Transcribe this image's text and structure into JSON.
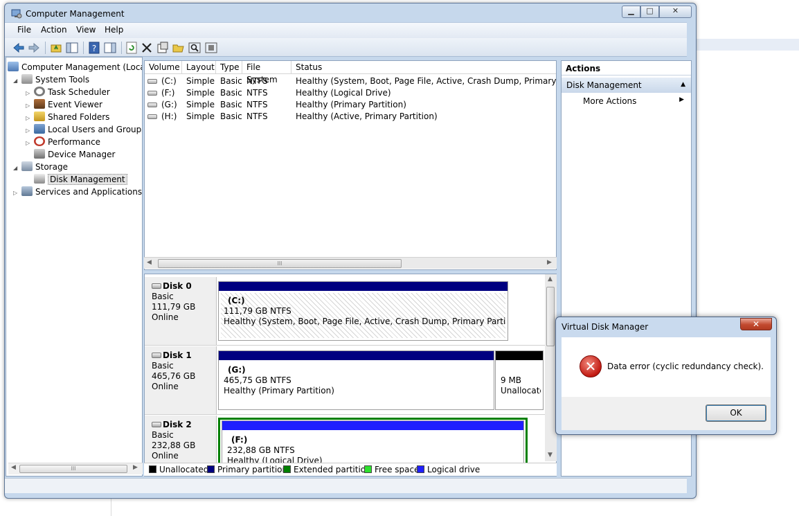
{
  "window": {
    "title": "Computer Management",
    "controls": {
      "minimize": "▁",
      "maximize": "□",
      "close": "✕"
    }
  },
  "menu": [
    "File",
    "Action",
    "View",
    "Help"
  ],
  "toolbar_icons": [
    "back-icon",
    "forward-icon",
    "up-folder-icon",
    "show-hide-tree-icon",
    "help-icon",
    "show-hide-action-pane-icon",
    "refresh-icon",
    "delete-icon",
    "properties-icon",
    "open-icon",
    "search-icon",
    "settings-icon"
  ],
  "tree": {
    "root": "Computer Management (Local",
    "system_tools": "System Tools",
    "items": [
      "Task Scheduler",
      "Event Viewer",
      "Shared Folders",
      "Local Users and Groups",
      "Performance",
      "Device Manager"
    ],
    "storage": "Storage",
    "disk_management": "Disk Management",
    "services": "Services and Applications"
  },
  "volumes": {
    "headers": [
      "Volume",
      "Layout",
      "Type",
      "File System",
      "Status"
    ],
    "rows": [
      {
        "volume": "(C:)",
        "layout": "Simple",
        "type": "Basic",
        "fs": "NTFS",
        "status": "Healthy (System, Boot, Page File, Active, Crash Dump, Primary Partition)"
      },
      {
        "volume": "(F:)",
        "layout": "Simple",
        "type": "Basic",
        "fs": "NTFS",
        "status": "Healthy (Logical Drive)"
      },
      {
        "volume": "(G:)",
        "layout": "Simple",
        "type": "Basic",
        "fs": "NTFS",
        "status": "Healthy (Primary Partition)"
      },
      {
        "volume": "(H:)",
        "layout": "Simple",
        "type": "Basic",
        "fs": "NTFS",
        "status": "Healthy (Active, Primary Partition)"
      }
    ]
  },
  "scroll_grip": "lll",
  "disks": [
    {
      "name": "Disk 0",
      "type": "Basic",
      "size": "111,79 GB",
      "state": "Online",
      "partitions": [
        {
          "label": "(C:)",
          "size": "111,79 GB NTFS",
          "status": "Healthy (System, Boot, Page File, Active, Crash Dump, Primary Partition)"
        }
      ]
    },
    {
      "name": "Disk 1",
      "type": "Basic",
      "size": "465,76 GB",
      "state": "Online",
      "partitions": [
        {
          "label": "(G:)",
          "size": "465,75 GB NTFS",
          "status": "Healthy (Primary Partition)"
        },
        {
          "label": "",
          "size": "9 MB",
          "status": "Unallocate"
        }
      ]
    },
    {
      "name": "Disk 2",
      "type": "Basic",
      "size": "232,88 GB",
      "state": "Online",
      "partitions": [
        {
          "label": "(F:)",
          "size": "232,88 GB NTFS",
          "status": "Healthy (Logical Drive)"
        }
      ]
    }
  ],
  "legend": [
    {
      "label": "Unallocated",
      "color": "#000000"
    },
    {
      "label": "Primary partition",
      "color": "#000080"
    },
    {
      "label": "Extended partition",
      "color": "#008000"
    },
    {
      "label": "Free space",
      "color": "#2ee02e"
    },
    {
      "label": "Logical drive",
      "color": "#1f1fff"
    }
  ],
  "actions": {
    "header": "Actions",
    "section": "Disk Management",
    "more": "More Actions"
  },
  "dialog": {
    "title": "Virtual Disk Manager",
    "close": "✕",
    "icon": "error-icon",
    "message": "Data error (cyclic redundancy check).",
    "ok": "OK"
  }
}
